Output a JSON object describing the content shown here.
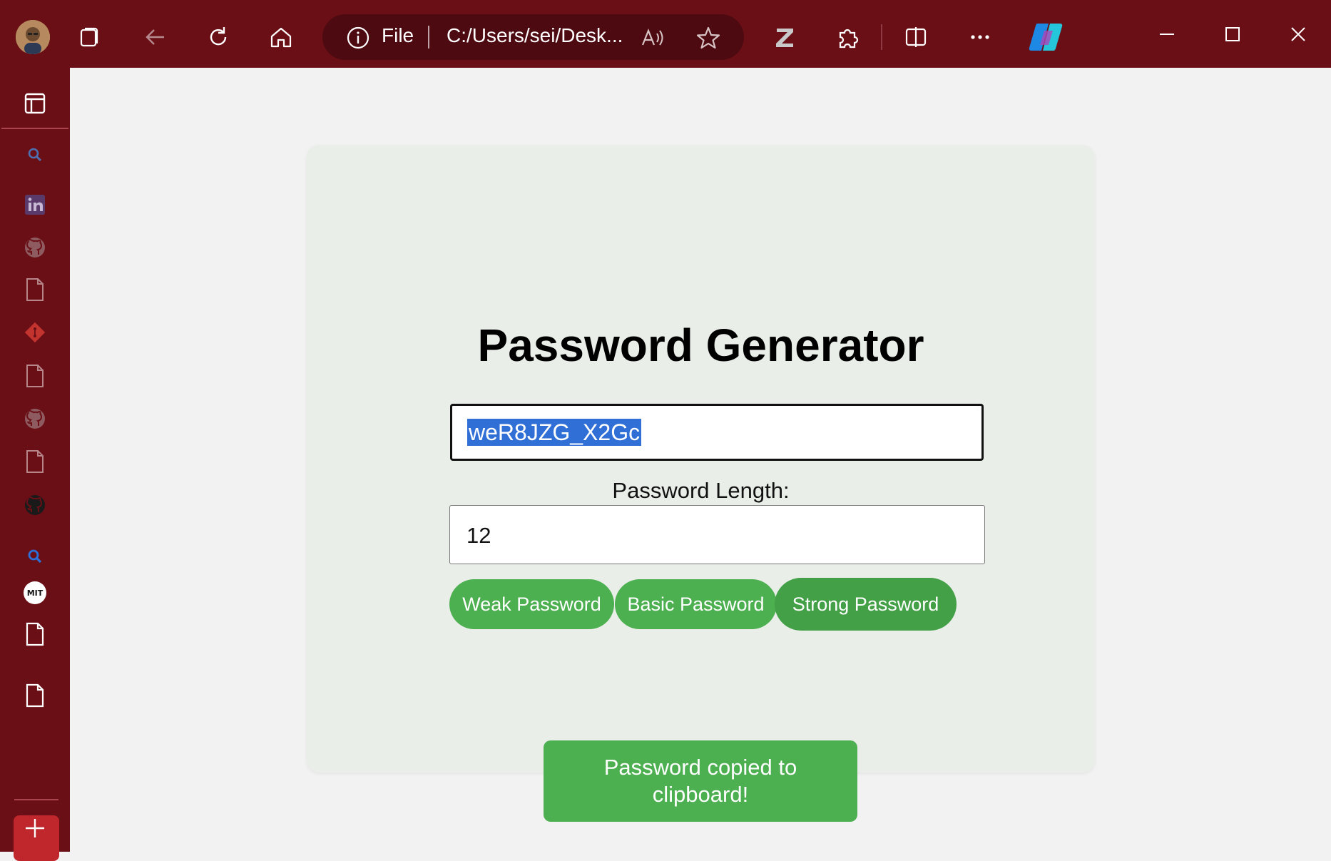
{
  "browser": {
    "address_scheme": "File",
    "address_url": "C:/Users/sei/Desk...",
    "theme_color": "#6b0f17"
  },
  "toolbar_icons": [
    "tabs-icon",
    "back-arrow-icon",
    "refresh-icon",
    "home-icon",
    "info-icon",
    "read-aloud-icon",
    "favorite-star-icon",
    "zotero-extension-icon",
    "extensions-puzzle-icon",
    "split-screen-icon",
    "more-options-icon",
    "copilot-icon",
    "minimize-icon",
    "maximize-icon",
    "close-icon"
  ],
  "sidebar_icons": [
    "sidebar-toggle-icon",
    "search-icon",
    "linkedin-icon",
    "github-icon",
    "document-icon",
    "git-icon",
    "document-icon",
    "github-icon",
    "document-icon",
    "github-icon",
    "search-icon",
    "mit-icon",
    "document-icon",
    "document-icon",
    "add-icon"
  ],
  "app": {
    "title": "Password Generator",
    "password_value": "weR8JZG_X2Gc",
    "length_label": "Password Length:",
    "length_value": "12",
    "buttons": {
      "weak": "Weak Password",
      "basic": "Basic Password",
      "strong": "Strong Password"
    },
    "toast": "Password copied to clipboard!",
    "accent_color": "#4caf50",
    "card_color": "#e9eee8"
  }
}
